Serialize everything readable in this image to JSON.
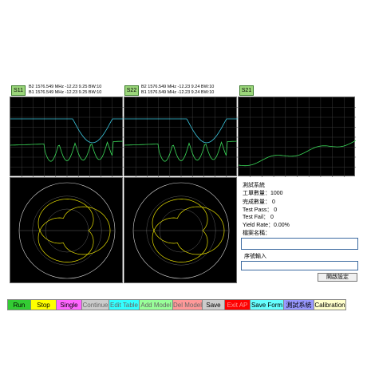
{
  "traces": [
    {
      "tag": "S11",
      "line1": "B2 1576.549 MHz -12.23 9.25 BW:10",
      "line2": "B1 1576.549 MHz -12.23 9.25 BW:10"
    },
    {
      "tag": "S22",
      "line1": "B2 1576.549 MHz -12.23 9.24 BW:10",
      "line2": "B1 1576.549 MHz -12.23 9.24 BW:10"
    },
    {
      "tag": "S21",
      "line1": "",
      "line2": ""
    }
  ],
  "info": {
    "system_title": "測試系統",
    "work_count": "工單數量：1000",
    "done_count": "完成數量：     0",
    "test_pass": "Test Pass：      0",
    "test_fail": "Test Fail：      0",
    "yield_rate": "Yield Rate：0.00%",
    "file_name_label": "檔案名稱：",
    "file_name_value": "",
    "barcode_label": "序號輸入",
    "barcode_value": "",
    "small_button": "開啟設定"
  },
  "buttons": [
    {
      "label": "Run",
      "bg": "#33cc33",
      "fg": "#000000"
    },
    {
      "label": "Stop",
      "bg": "#ffff00",
      "fg": "#000000"
    },
    {
      "label": "Single",
      "bg": "#ff66ff",
      "fg": "#000000"
    },
    {
      "label": "Continue",
      "bg": "#cccccc",
      "fg": "#666666"
    },
    {
      "label": "Edit Table",
      "bg": "#33ffff",
      "fg": "#666666"
    },
    {
      "label": "Add Model",
      "bg": "#99ff99",
      "fg": "#666666"
    },
    {
      "label": "Del Model",
      "bg": "#ff9999",
      "fg": "#666666"
    },
    {
      "label": "Save",
      "bg": "#cccccc",
      "fg": "#000000"
    },
    {
      "label": "Exit AP",
      "bg": "#ff0000",
      "fg": "#ff9999"
    },
    {
      "label": "Save Form",
      "bg": "#66ffff",
      "fg": "#000000"
    },
    {
      "label": "測試系統",
      "bg": "#9999ff",
      "fg": "#000000"
    },
    {
      "label": "Calibration",
      "bg": "#ffffcc",
      "fg": "#000000"
    }
  ],
  "colors": {
    "trace_yellow": "#e8e000",
    "trace_cyan": "#3cc8e0",
    "trace_green": "#3cdc5a",
    "grid": "#3a3a3a",
    "polar": "#d8d8d8"
  }
}
